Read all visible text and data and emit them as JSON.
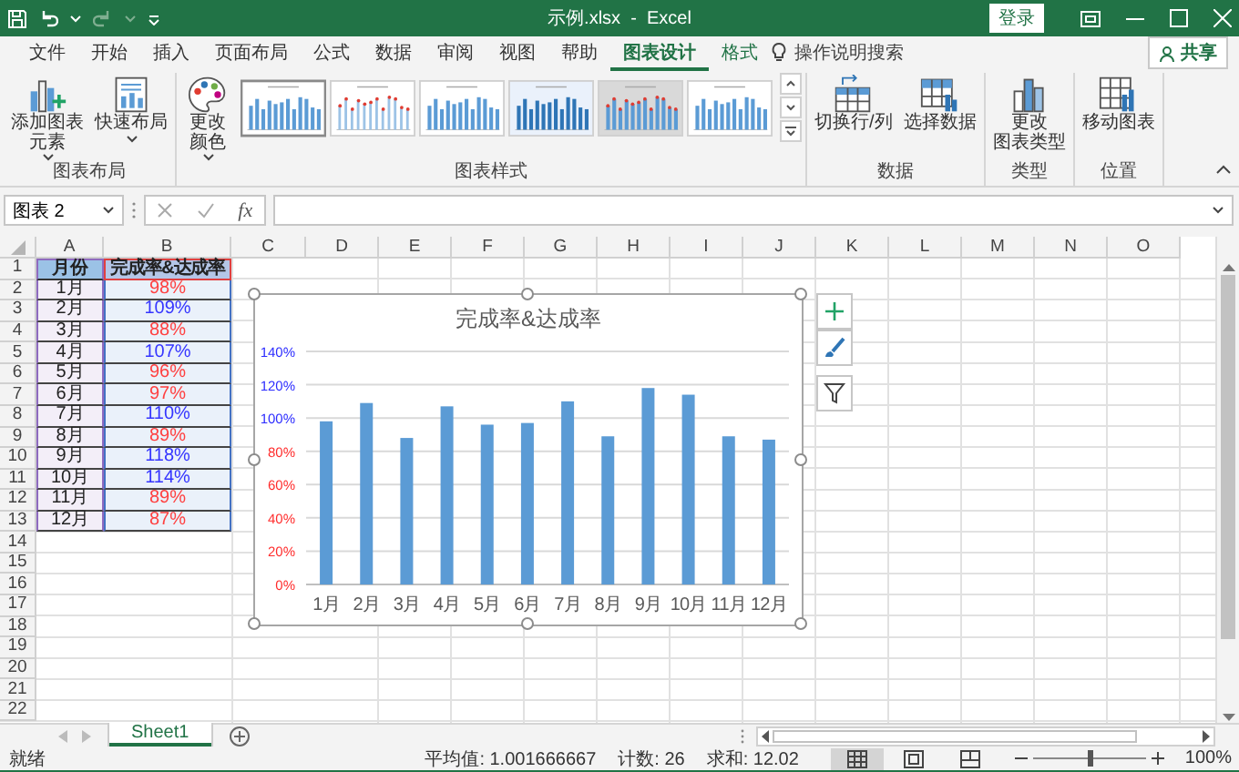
{
  "window": {
    "title": "示例.xlsx  -  Excel",
    "sign_in": "登录"
  },
  "ribbon_tabs": [
    {
      "label": "文件",
      "selected": false,
      "contextual": false
    },
    {
      "label": "开始",
      "selected": false,
      "contextual": false
    },
    {
      "label": "插入",
      "selected": false,
      "contextual": false
    },
    {
      "label": "页面布局",
      "selected": false,
      "contextual": false
    },
    {
      "label": "公式",
      "selected": false,
      "contextual": false
    },
    {
      "label": "数据",
      "selected": false,
      "contextual": false
    },
    {
      "label": "审阅",
      "selected": false,
      "contextual": false
    },
    {
      "label": "视图",
      "selected": false,
      "contextual": false
    },
    {
      "label": "帮助",
      "selected": false,
      "contextual": false
    },
    {
      "label": "图表设计",
      "selected": true,
      "contextual": true
    },
    {
      "label": "格式",
      "selected": false,
      "contextual": true
    }
  ],
  "tell_me": {
    "placeholder": "操作说明搜索"
  },
  "share": "共享",
  "ribbon_groups": [
    {
      "label": "图表布局",
      "buttons": [
        {
          "lines": [
            "添加图表",
            "元素"
          ],
          "dropdown": true
        },
        {
          "lines": [
            "快速布局"
          ],
          "dropdown": true
        }
      ]
    },
    {
      "label": "图表样式",
      "buttons": [
        {
          "lines": [
            "更改",
            "颜色"
          ],
          "dropdown": true
        }
      ],
      "styles": [
        {
          "selected": true
        },
        {
          "selected": false
        },
        {
          "selected": false
        },
        {
          "selected": false
        },
        {
          "selected": false
        },
        {
          "selected": false
        }
      ]
    },
    {
      "label": "数据",
      "buttons": [
        {
          "lines": [
            "切换行/列"
          ],
          "dropdown": false
        },
        {
          "lines": [
            "选择数据"
          ],
          "dropdown": false
        }
      ]
    },
    {
      "label": "类型",
      "buttons": [
        {
          "lines": [
            "更改",
            "图表类型"
          ],
          "dropdown": false
        }
      ]
    },
    {
      "label": "位置",
      "buttons": [
        {
          "lines": [
            "移动图表"
          ],
          "dropdown": false
        }
      ]
    }
  ],
  "formula_bar": {
    "name_box": "图表 2",
    "fx": "fx"
  },
  "sheet": {
    "columns": [
      "A",
      "B",
      "C",
      "D",
      "E",
      "F",
      "G",
      "H",
      "I",
      "J",
      "K",
      "L",
      "M",
      "N",
      "O"
    ],
    "rows": [
      "1",
      "2",
      "3",
      "4",
      "5",
      "6",
      "7",
      "8",
      "9",
      "10",
      "11",
      "12",
      "13",
      "14",
      "15",
      "16",
      "17",
      "18",
      "19",
      "20",
      "21",
      "22"
    ],
    "header": [
      "月份",
      "完成率&达成率"
    ],
    "data": [
      {
        "month": "1月",
        "value": "98%",
        "color": "#ff4040"
      },
      {
        "month": "2月",
        "value": "109%",
        "color": "#3535ff"
      },
      {
        "month": "3月",
        "value": "88%",
        "color": "#ff4040"
      },
      {
        "month": "4月",
        "value": "107%",
        "color": "#3535ff"
      },
      {
        "month": "5月",
        "value": "96%",
        "color": "#ff4040"
      },
      {
        "month": "6月",
        "value": "97%",
        "color": "#ff4040"
      },
      {
        "month": "7月",
        "value": "110%",
        "color": "#3535ff"
      },
      {
        "month": "8月",
        "value": "89%",
        "color": "#ff4040"
      },
      {
        "month": "9月",
        "value": "118%",
        "color": "#3535ff"
      },
      {
        "month": "10月",
        "value": "114%",
        "color": "#3535ff"
      },
      {
        "month": "11月",
        "value": "89%",
        "color": "#ff4040"
      },
      {
        "month": "12月",
        "value": "87%",
        "color": "#ff4040"
      }
    ]
  },
  "chart": {
    "chart_data": {
      "type": "bar",
      "title": "完成率&达成率",
      "categories": [
        "1月",
        "2月",
        "3月",
        "4月",
        "5月",
        "6月",
        "7月",
        "8月",
        "9月",
        "10月",
        "11月",
        "12月"
      ],
      "grid": true,
      "series": [
        {
          "color": "#5b9bd5",
          "values": [
            98,
            109,
            88,
            107,
            96,
            97,
            110,
            89,
            118,
            114,
            89,
            87
          ]
        }
      ],
      "ylim": [
        0,
        140
      ],
      "yticks": [
        {
          "value": 0,
          "label": "0%"
        },
        {
          "value": 20,
          "label": "20%"
        },
        {
          "value": 40,
          "label": "40%"
        },
        {
          "value": 60,
          "label": "60%"
        },
        {
          "value": 80,
          "label": "80%"
        },
        {
          "value": 100,
          "label": "100%"
        },
        {
          "value": 120,
          "label": "120%"
        },
        {
          "value": 140,
          "label": "140%"
        }
      ]
    }
  },
  "sheet_tabs": [
    {
      "label": "Sheet1",
      "selected": true
    }
  ],
  "status_bar": {
    "ready": "就绪",
    "stats": [
      "平均值: 1.001666667",
      "计数: 26",
      "求和: 12.02"
    ],
    "views": [
      {
        "selected": true
      },
      {
        "selected": false
      },
      {
        "selected": false
      }
    ],
    "zoom": {
      "level": 0.5,
      "reading": "100%"
    }
  }
}
